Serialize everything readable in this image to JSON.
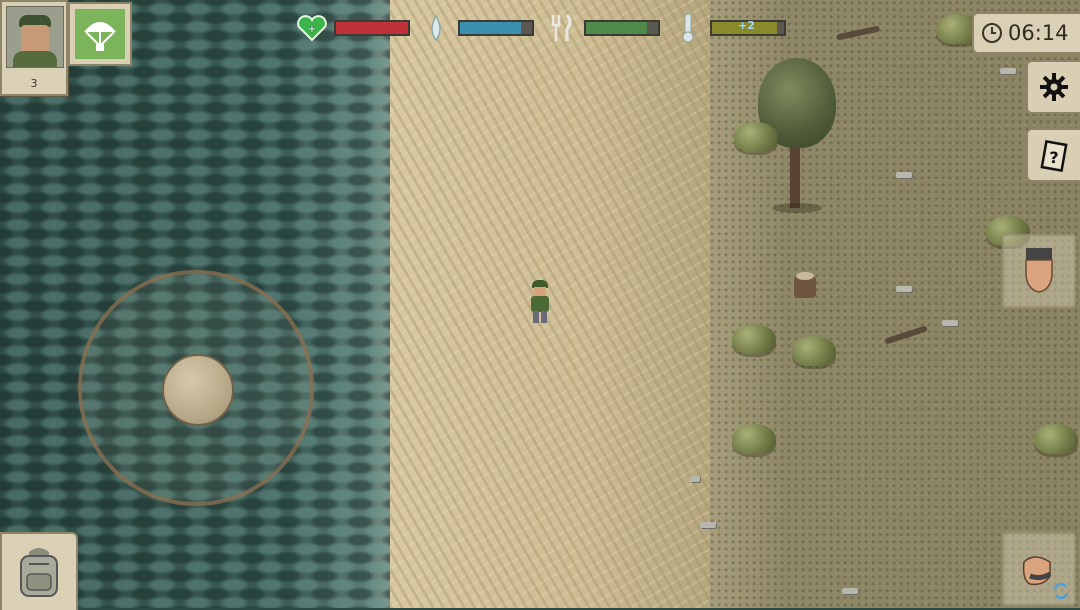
{
  "hud": {
    "player_level": "3",
    "clock_time": "06:14",
    "stats": {
      "health": {
        "icon": "heart-plus-icon",
        "fill_percent": 100,
        "color": "#c0323a"
      },
      "water": {
        "icon": "water-drop-icon",
        "fill_percent": 85,
        "color": "#3b8fb0"
      },
      "food": {
        "icon": "fork-knife-icon",
        "fill_percent": 85,
        "color": "#4e8a4a"
      },
      "temperature": {
        "icon": "thermometer-icon",
        "fill_percent": 90,
        "color": "#8a8a2a",
        "label": "+2"
      }
    }
  },
  "colors": {
    "water": "#3a5a54",
    "sand": "#d2c29a",
    "grass": "#8f8866",
    "panel": "#d9d0b6"
  }
}
